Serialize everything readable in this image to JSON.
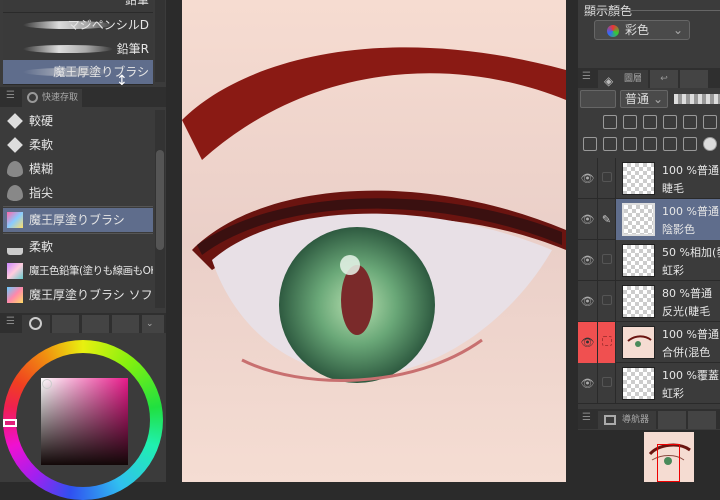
{
  "brush_list": {
    "items": [
      {
        "label": "鉛筆"
      },
      {
        "label": "マジペンシルD"
      },
      {
        "label": "鉛筆R"
      },
      {
        "label": "魔王厚塗りブラシ",
        "selected": true
      }
    ]
  },
  "quick_access": {
    "tab_label": "快速存取",
    "items": [
      {
        "label": "較硬",
        "icon": "eraser-icon"
      },
      {
        "label": "柔軟",
        "icon": "eraser-icon"
      },
      {
        "label": "模糊",
        "icon": "blend-drops-icon"
      },
      {
        "label": "指尖",
        "icon": "blend-drops-icon"
      },
      {
        "label": "魔王厚塗りブラシ",
        "icon": "brush-thumbnail-icon",
        "selected": true
      },
      {
        "label": "柔軟",
        "icon": "airbrush-icon"
      },
      {
        "label": "魔王色鉛筆(塗りも線画もOK！)",
        "icon": "brush-thumbnail-icon"
      },
      {
        "label": "魔王厚塗りブラシ ソフト",
        "icon": "brush-thumbnail-icon"
      }
    ]
  },
  "color": {
    "current": "#e0207a",
    "hue_marker": "#e0207a"
  },
  "display_color": {
    "label": "顯示顏色",
    "value": "彩色"
  },
  "layer_panel": {
    "tab_label": "圖層",
    "blend_mode": "普通",
    "layers": [
      {
        "opacity_mode": "100 %普通",
        "name": "睫毛"
      },
      {
        "opacity_mode": "100 %普通",
        "name": "陰影色",
        "selected": true
      },
      {
        "opacity_mode": "50 %相加(發",
        "name": "虹彩"
      },
      {
        "opacity_mode": "80 %普通",
        "name": "反光(睫毛"
      },
      {
        "opacity_mode": "100 %普通",
        "name": "合併(混色",
        "reference": true
      },
      {
        "opacity_mode": "100 %覆蓋",
        "name": "虹彩"
      }
    ]
  },
  "navigator": {
    "tab_label": "導航器"
  }
}
